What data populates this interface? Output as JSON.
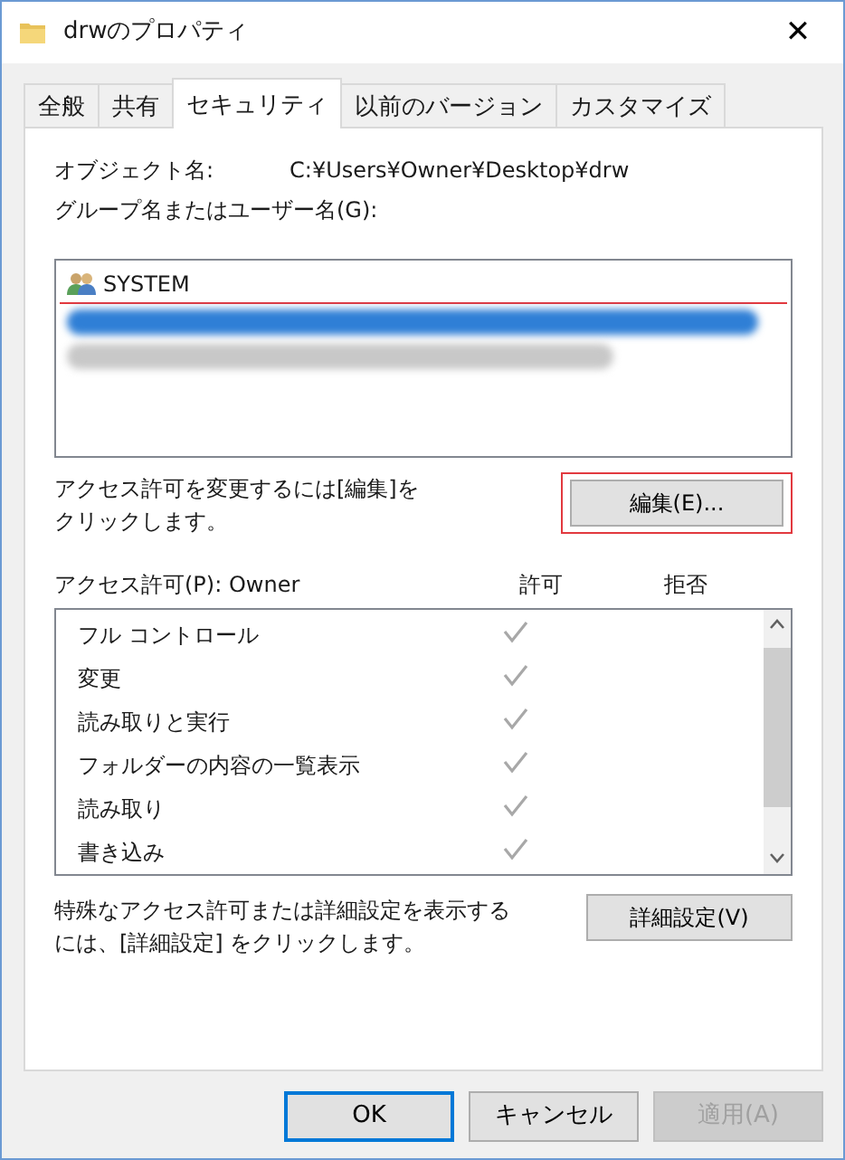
{
  "window": {
    "title": "drwのプロパティ",
    "close": "✕"
  },
  "tabs": [
    {
      "label": "全般",
      "selected": false
    },
    {
      "label": "共有",
      "selected": false
    },
    {
      "label": "セキュリティ",
      "selected": true
    },
    {
      "label": "以前のバージョン",
      "selected": false
    },
    {
      "label": "カスタマイズ",
      "selected": false
    }
  ],
  "object_name": {
    "label": "オブジェクト名:",
    "value": "C:¥Users¥Owner¥Desktop¥drw"
  },
  "groups_label": "グループ名またはユーザー名(G):",
  "groups": [
    {
      "kind": "user",
      "name": "SYSTEM",
      "selected": false,
      "highlighted": false
    },
    {
      "kind": "blurred",
      "selected": true,
      "highlighted": true
    },
    {
      "kind": "blurred",
      "selected": false,
      "highlighted": false
    }
  ],
  "edit_hint": "アクセス許可を変更するには[編集]をクリックします。",
  "edit_button": {
    "label": "編集(E)...",
    "highlighted": true
  },
  "permissions": {
    "label": "アクセス許可(P): Owner",
    "allow_header": "許可",
    "deny_header": "拒否",
    "rows": [
      {
        "name": "フル コントロール",
        "allow": true,
        "deny": false
      },
      {
        "name": "変更",
        "allow": true,
        "deny": false
      },
      {
        "name": "読み取りと実行",
        "allow": true,
        "deny": false
      },
      {
        "name": "フォルダーの内容の一覧表示",
        "allow": true,
        "deny": false
      },
      {
        "name": "読み取り",
        "allow": true,
        "deny": false
      },
      {
        "name": "書き込み",
        "allow": true,
        "deny": false
      }
    ]
  },
  "advanced_hint": "特殊なアクセス許可または詳細設定を表示するには、[詳細設定] をクリックします。",
  "advanced_button": "詳細設定(V)",
  "buttons": [
    {
      "label": "OK",
      "default": true,
      "disabled": false
    },
    {
      "label": "キャンセル",
      "default": false,
      "disabled": false
    },
    {
      "label": "適用(A)",
      "default": false,
      "disabled": true
    }
  ]
}
